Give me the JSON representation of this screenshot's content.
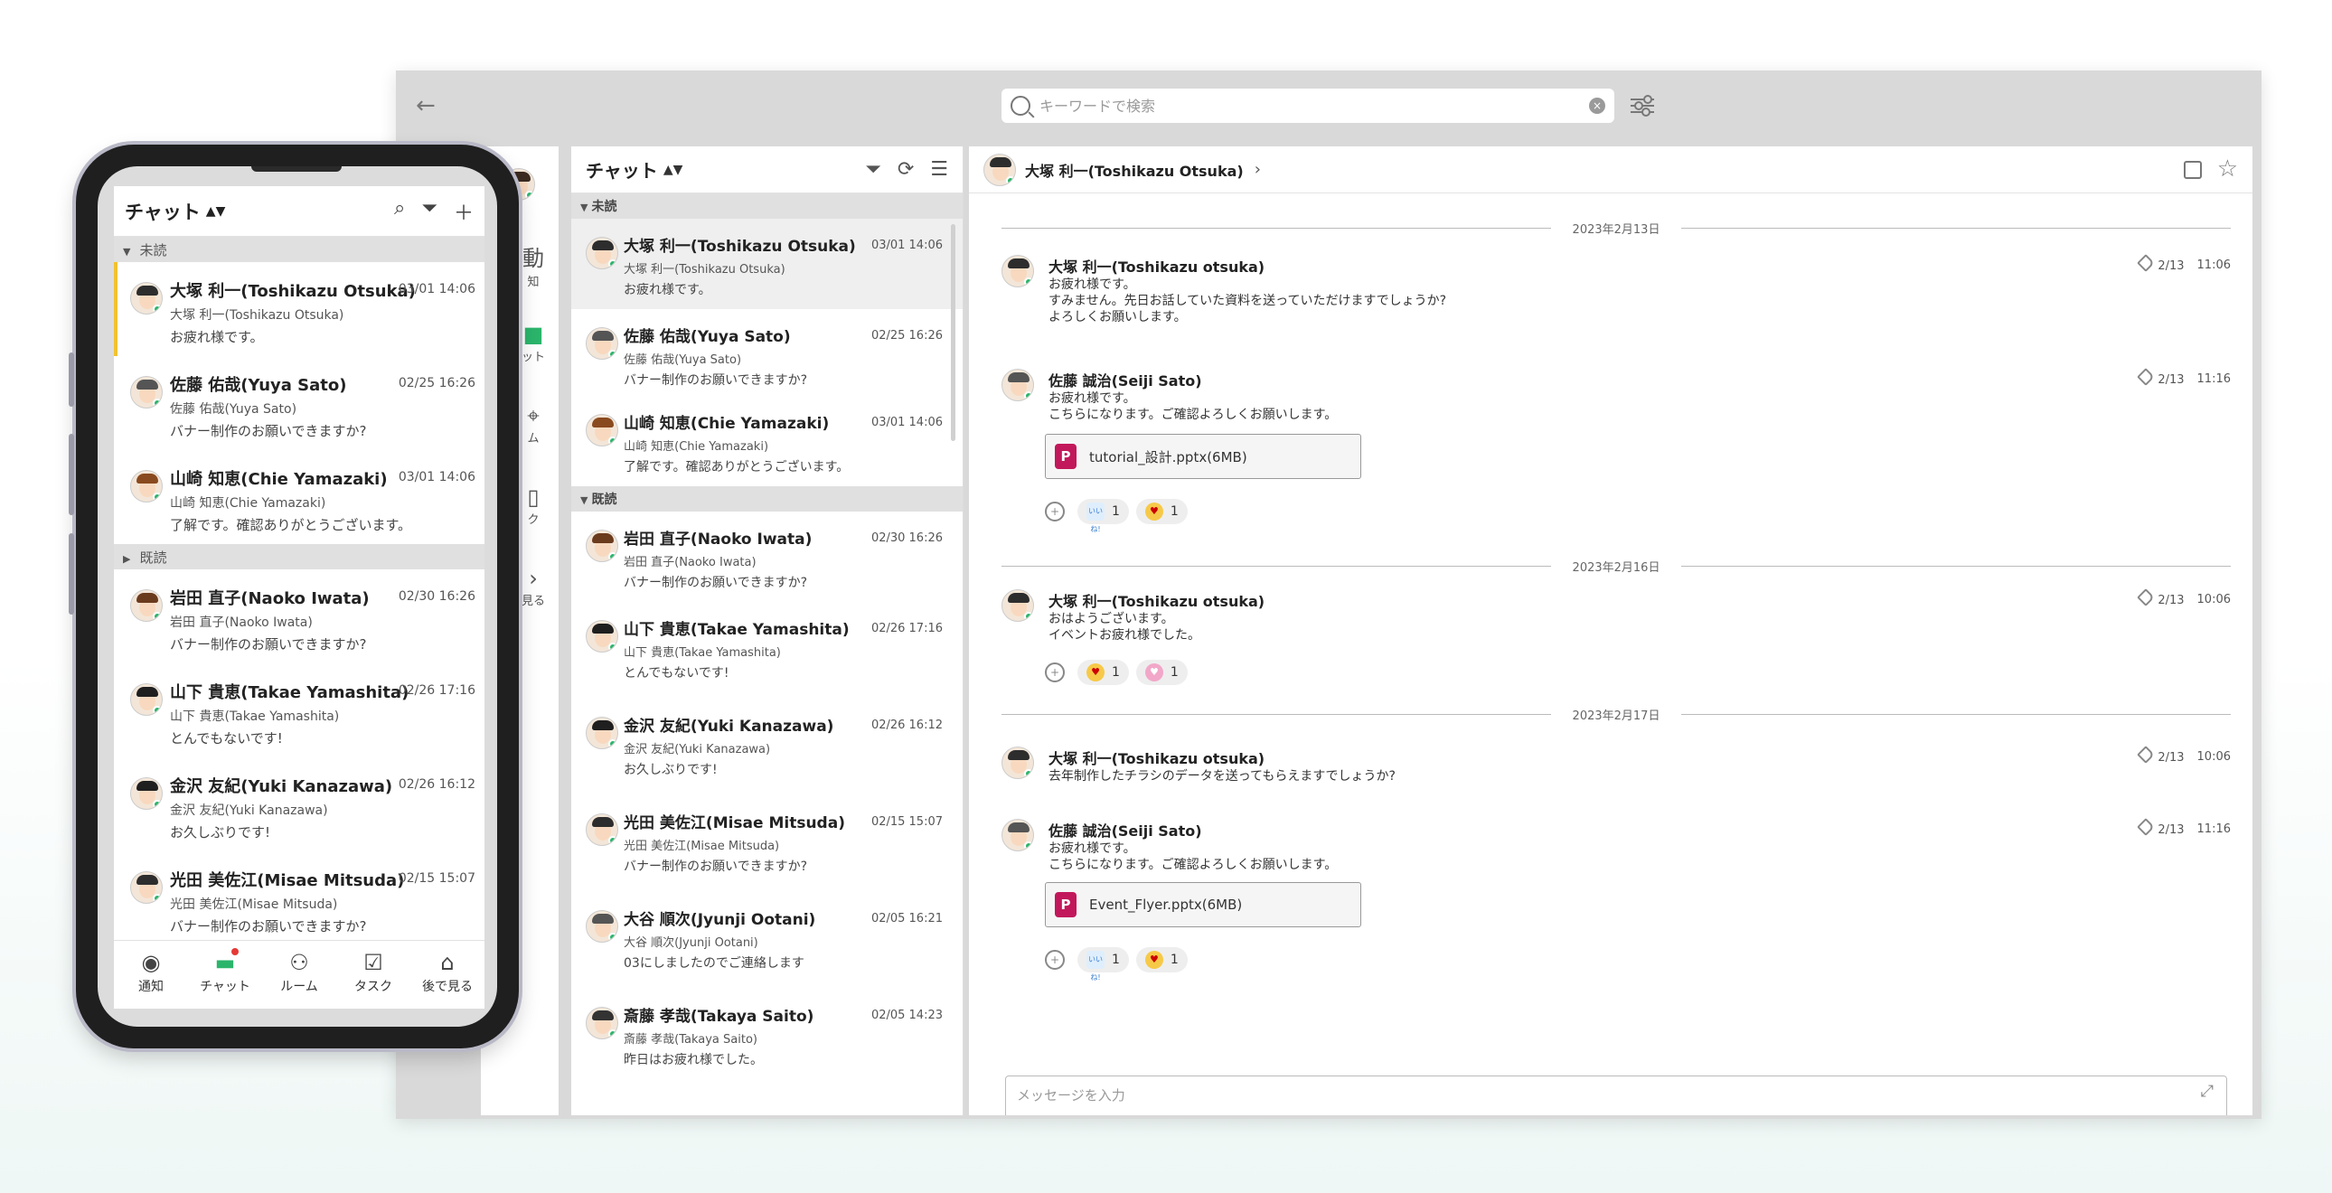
{
  "desktop": {
    "search_placeholder": "キーワードで検索",
    "rail": {
      "items": [
        {
          "label": "知",
          "icon": "broadcast-icon"
        },
        {
          "label": "ット",
          "icon": "chat-icon"
        },
        {
          "label": "ム",
          "icon": "room-icon"
        },
        {
          "label": "ク",
          "icon": "task-icon"
        },
        {
          "label": "見る",
          "icon": "later-icon"
        }
      ]
    },
    "list": {
      "title": "チャット",
      "unread_label": "未読",
      "read_label": "既読",
      "unread": [
        {
          "name": "大塚 利一(Toshikazu Otsuka)",
          "sub": "大塚 利一(Toshikazu Otsuka)",
          "msg": "お疲れ様です。",
          "time": "03/01 14:06"
        },
        {
          "name": "佐藤 佑哉(Yuya Sato)",
          "sub": "佐藤 佑哉(Yuya Sato)",
          "msg": "バナー制作のお願いできますか?",
          "time": "02/25 16:26"
        },
        {
          "name": "山崎 知恵(Chie Yamazaki)",
          "sub": "山崎 知恵(Chie Yamazaki)",
          "msg": "了解です。確認ありがとうございます。",
          "time": "03/01 14:06"
        }
      ],
      "read": [
        {
          "name": "岩田 直子(Naoko Iwata)",
          "sub": "岩田 直子(Naoko Iwata)",
          "msg": "バナー制作のお願いできますか?",
          "time": "02/30 16:26"
        },
        {
          "name": "山下 貴恵(Takae Yamashita)",
          "sub": "山下 貴恵(Takae Yamashita)",
          "msg": "とんでもないです!",
          "time": "02/26 17:16"
        },
        {
          "name": "金沢 友紀(Yuki Kanazawa)",
          "sub": "金沢 友紀(Yuki Kanazawa)",
          "msg": "お久しぶりです!",
          "time": "02/26 16:12"
        },
        {
          "name": "光田 美佐江(Misae Mitsuda)",
          "sub": "光田 美佐江(Misae Mitsuda)",
          "msg": "バナー制作のお願いできますか?",
          "time": "02/15 15:07"
        },
        {
          "name": "大谷 順次(Jyunji Ootani)",
          "sub": "大谷 順次(Jyunji Ootani)",
          "msg": "03にしましたのでご連絡します",
          "time": "02/05 16:21"
        },
        {
          "name": "斎藤 孝哉(Takaya Saito)",
          "sub": "斎藤 孝哉(Takaya Saito)",
          "msg": "昨日はお疲れ様でした。",
          "time": "02/05 14:23"
        }
      ]
    },
    "chat": {
      "header_name": "大塚 利一(Toshikazu Otsuka)",
      "dates": [
        "2023年2月13日",
        "2023年2月16日",
        "2023年2月17日"
      ],
      "messages": [
        {
          "name": "大塚 利一(Toshikazu otsuka)",
          "text": "お疲れ様です。\nすみません。先日お話していた資料を送っていただけますでしょうか?\nよろしくお願いします。",
          "date": "2/13",
          "time": "11:06"
        },
        {
          "name": "佐藤 誠治(Seiji Sato)",
          "text": "お疲れ様です。\nこちらになります。ご確認よろしくお願いします。",
          "date": "2/13",
          "time": "11:16",
          "file": "tutorial_設計.pptx(6MB)",
          "reactions": [
            {
              "emoji": "いいね!",
              "count": "1"
            },
            {
              "emoji": "love-eyes",
              "count": "1"
            }
          ]
        },
        {
          "name": "大塚 利一(Toshikazu otsuka)",
          "text": "おはようございます。\nイベントお疲れ様でした。",
          "date": "2/13",
          "time": "10:06",
          "reactions": [
            {
              "emoji": "love-eyes",
              "count": "1"
            },
            {
              "emoji": "heart",
              "count": "1"
            }
          ]
        },
        {
          "name": "大塚 利一(Toshikazu otsuka)",
          "text": "去年制作したチラシのデータを送ってもらえますでしょうか?",
          "date": "2/13",
          "time": "10:06"
        },
        {
          "name": "佐藤 誠治(Seiji Sato)",
          "text": "お疲れ様です。\nこちらになります。ご確認よろしくお願いします。",
          "date": "2/13",
          "time": "11:16",
          "file": "Event_Flyer.pptx(6MB)",
          "reactions": [
            {
              "emoji": "いいね!",
              "count": "1"
            },
            {
              "emoji": "love-eyes",
              "count": "1"
            }
          ]
        }
      ],
      "composer_placeholder": "メッセージを入力"
    }
  },
  "phone": {
    "title": "チャット",
    "unread_label": "未読",
    "read_label": "既読",
    "unread": [
      {
        "name": "大塚 利一(Toshikazu Otsuka)",
        "sub": "大塚 利一(Toshikazu Otsuka)",
        "msg": "お疲れ様です。",
        "time": "03/01 14:06"
      },
      {
        "name": "佐藤 佑哉(Yuya Sato)",
        "sub": "佐藤 佑哉(Yuya Sato)",
        "msg": "バナー制作のお願いできますか?",
        "time": "02/25 16:26"
      },
      {
        "name": "山崎 知恵(Chie Yamazaki)",
        "sub": "山崎 知恵(Chie Yamazaki)",
        "msg": "了解です。確認ありがとうございます。",
        "time": "03/01 14:06"
      }
    ],
    "read": [
      {
        "name": "岩田 直子(Naoko Iwata)",
        "sub": "岩田 直子(Naoko Iwata)",
        "msg": "バナー制作のお願いできますか?",
        "time": "02/30 16:26"
      },
      {
        "name": "山下 貴恵(Takae Yamashita)",
        "sub": "山下 貴恵(Takae Yamashita)",
        "msg": "とんでもないです!",
        "time": "02/26 17:16"
      },
      {
        "name": "金沢 友紀(Yuki Kanazawa)",
        "sub": "金沢 友紀(Yuki Kanazawa)",
        "msg": "お久しぶりです!",
        "time": "02/26 16:12"
      },
      {
        "name": "光田 美佐江(Misae Mitsuda)",
        "sub": "光田 美佐江(Misae Mitsuda)",
        "msg": "バナー制作のお願いできますか?",
        "time": "02/15 15:07"
      }
    ],
    "nav": [
      {
        "label": "通知",
        "icon": "broadcast-icon"
      },
      {
        "label": "チャット",
        "icon": "chat-icon"
      },
      {
        "label": "ルーム",
        "icon": "room-icon"
      },
      {
        "label": "タスク",
        "icon": "task-icon"
      },
      {
        "label": "後で見る",
        "icon": "tag-icon"
      }
    ]
  },
  "colors": {
    "accent": "#2bb56b",
    "unread_marker": "#f1c232",
    "ppt": "#c2185b",
    "badge": "#e53935"
  }
}
